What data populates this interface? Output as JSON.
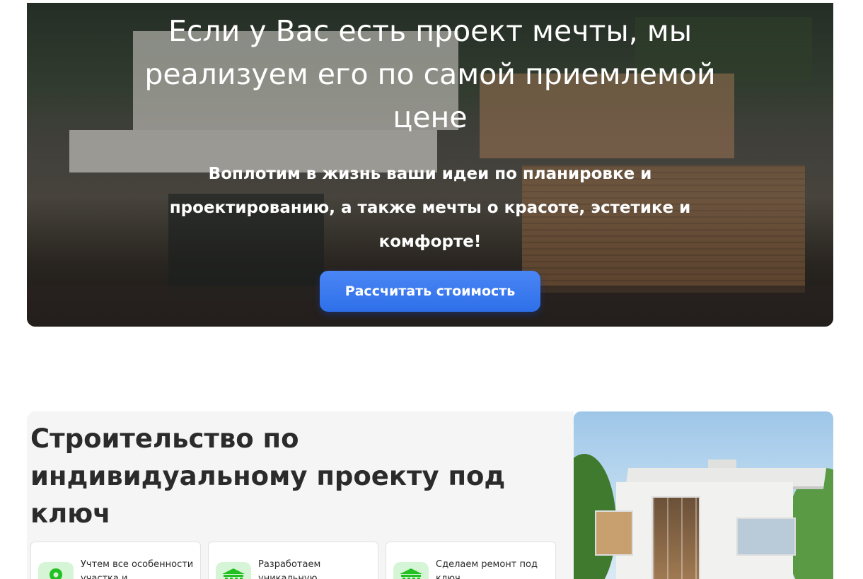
{
  "hero": {
    "title": "Если у Вас есть проект мечты, мы реализуем его по самой приемлемой цене",
    "subtitle": "Воплотим в жизнь ваши идеи по планировке и проектированию, а также мечты о красоте, эстетике и комфорте!",
    "cta_label": "Рассчитать стоимость"
  },
  "section": {
    "title": "Строительство по индивидуальному проекту под ключ",
    "cards": [
      {
        "icon": "location-pin-icon",
        "text": "Учтем все особенности участка и"
      },
      {
        "icon": "building-icon",
        "text": "Разработаем уникальную"
      },
      {
        "icon": "building-icon",
        "text": "Сделаем ремонт под ключ"
      }
    ]
  },
  "colors": {
    "accent": "#2e6fe9",
    "icon_green": "#22c022",
    "icon_bg": "#d6f5d6",
    "panel_bg": "#f5f5f5"
  }
}
